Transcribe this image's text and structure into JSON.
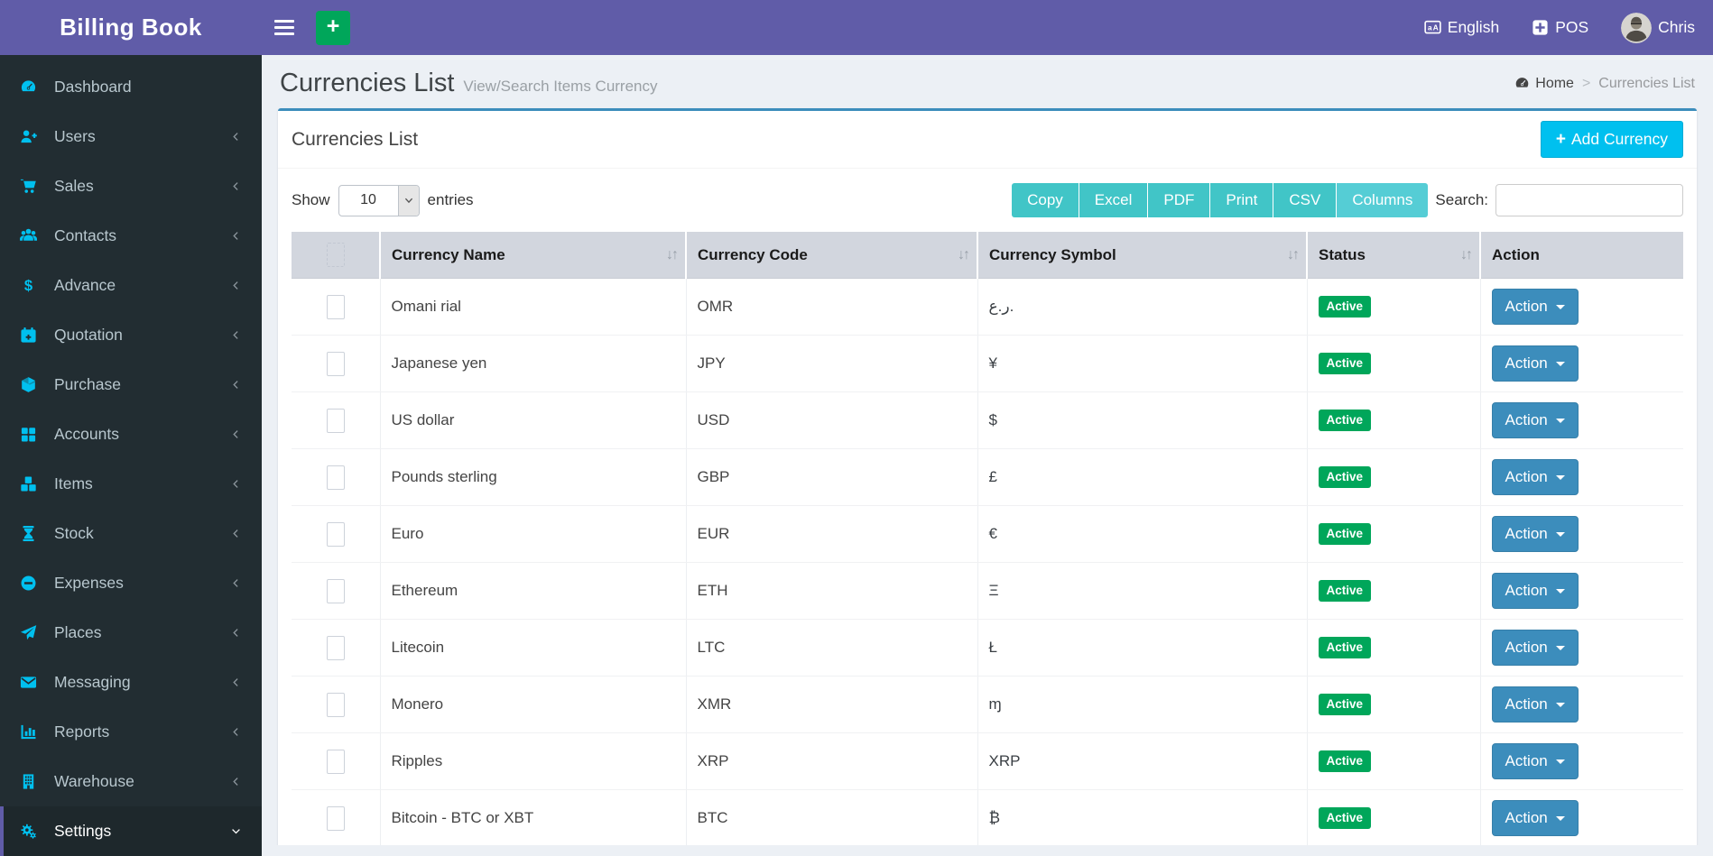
{
  "app": {
    "title": "Billing Book"
  },
  "navbar": {
    "language_label": "English",
    "pos_label": "POS",
    "user_name": "Chris"
  },
  "page_header": {
    "title": "Currencies List",
    "subtitle": "View/Search Items Currency",
    "breadcrumb_home": "Home",
    "breadcrumb_separator": ">",
    "breadcrumb_current": "Currencies List"
  },
  "sidebar": {
    "items": [
      {
        "label": "Dashboard",
        "icon": "dashboard-icon",
        "chevron": "none",
        "active": false
      },
      {
        "label": "Users",
        "icon": "users-icon",
        "chevron": "left",
        "active": false
      },
      {
        "label": "Sales",
        "icon": "sales-icon",
        "chevron": "left",
        "active": false
      },
      {
        "label": "Contacts",
        "icon": "contacts-icon",
        "chevron": "left",
        "active": false
      },
      {
        "label": "Advance",
        "icon": "advance-icon",
        "chevron": "left",
        "active": false
      },
      {
        "label": "Quotation",
        "icon": "quotation-icon",
        "chevron": "left",
        "active": false
      },
      {
        "label": "Purchase",
        "icon": "purchase-icon",
        "chevron": "left",
        "active": false
      },
      {
        "label": "Accounts",
        "icon": "accounts-icon",
        "chevron": "left",
        "active": false
      },
      {
        "label": "Items",
        "icon": "items-icon",
        "chevron": "left",
        "active": false
      },
      {
        "label": "Stock",
        "icon": "stock-icon",
        "chevron": "left",
        "active": false
      },
      {
        "label": "Expenses",
        "icon": "expenses-icon",
        "chevron": "left",
        "active": false
      },
      {
        "label": "Places",
        "icon": "places-icon",
        "chevron": "left",
        "active": false
      },
      {
        "label": "Messaging",
        "icon": "messaging-icon",
        "chevron": "left",
        "active": false
      },
      {
        "label": "Reports",
        "icon": "reports-icon",
        "chevron": "left",
        "active": false
      },
      {
        "label": "Warehouse",
        "icon": "warehouse-icon",
        "chevron": "left",
        "active": false
      },
      {
        "label": "Settings",
        "icon": "settings-icon",
        "chevron": "down",
        "active": true
      }
    ]
  },
  "card": {
    "title": "Currencies List",
    "add_button_label": "Add Currency"
  },
  "table_controls": {
    "show_label": "Show",
    "entries_value": "10",
    "entries_label": "entries",
    "export_buttons": [
      {
        "label": "Copy",
        "active": false
      },
      {
        "label": "Excel",
        "active": false
      },
      {
        "label": "PDF",
        "active": false
      },
      {
        "label": "Print",
        "active": false
      },
      {
        "label": "CSV",
        "active": false
      },
      {
        "label": "Columns",
        "active": true
      }
    ],
    "search_label": "Search:",
    "search_value": ""
  },
  "table": {
    "sort_icon": "↓↑",
    "columns": [
      {
        "label": "Currency Name",
        "sortable": true
      },
      {
        "label": "Currency Code",
        "sortable": true
      },
      {
        "label": "Currency Symbol",
        "sortable": true
      },
      {
        "label": "Status",
        "sortable": true
      },
      {
        "label": "Action",
        "sortable": false
      }
    ],
    "rows": [
      {
        "name": "Omani rial",
        "code": "OMR",
        "symbol": "ر.ع.",
        "status": "Active",
        "action": "Action"
      },
      {
        "name": "Japanese yen",
        "code": "JPY",
        "symbol": "¥",
        "status": "Active",
        "action": "Action"
      },
      {
        "name": "US dollar",
        "code": "USD",
        "symbol": "$",
        "status": "Active",
        "action": "Action"
      },
      {
        "name": "Pounds sterling",
        "code": "GBP",
        "symbol": "£",
        "status": "Active",
        "action": "Action"
      },
      {
        "name": "Euro",
        "code": "EUR",
        "symbol": "€",
        "status": "Active",
        "action": "Action"
      },
      {
        "name": "Ethereum",
        "code": "ETH",
        "symbol": "Ξ",
        "status": "Active",
        "action": "Action"
      },
      {
        "name": "Litecoin",
        "code": "LTC",
        "symbol": "Ł",
        "status": "Active",
        "action": "Action"
      },
      {
        "name": "Monero",
        "code": "XMR",
        "symbol": "ɱ",
        "status": "Active",
        "action": "Action"
      },
      {
        "name": "Ripples",
        "code": "XRP",
        "symbol": "XRP",
        "status": "Active",
        "action": "Action"
      },
      {
        "name": "Bitcoin - BTC or XBT",
        "code": "BTC",
        "symbol": "₿",
        "status": "Active",
        "action": "Action"
      }
    ]
  },
  "colors": {
    "navbar_purple": "#605ca8",
    "sidebar_dark": "#222d32",
    "accent_cyan": "#00c0ef",
    "success_green": "#00a65a",
    "primary_blue": "#3c8dbc",
    "export_teal": "#41c5c7",
    "background": "#ecf0f5"
  }
}
